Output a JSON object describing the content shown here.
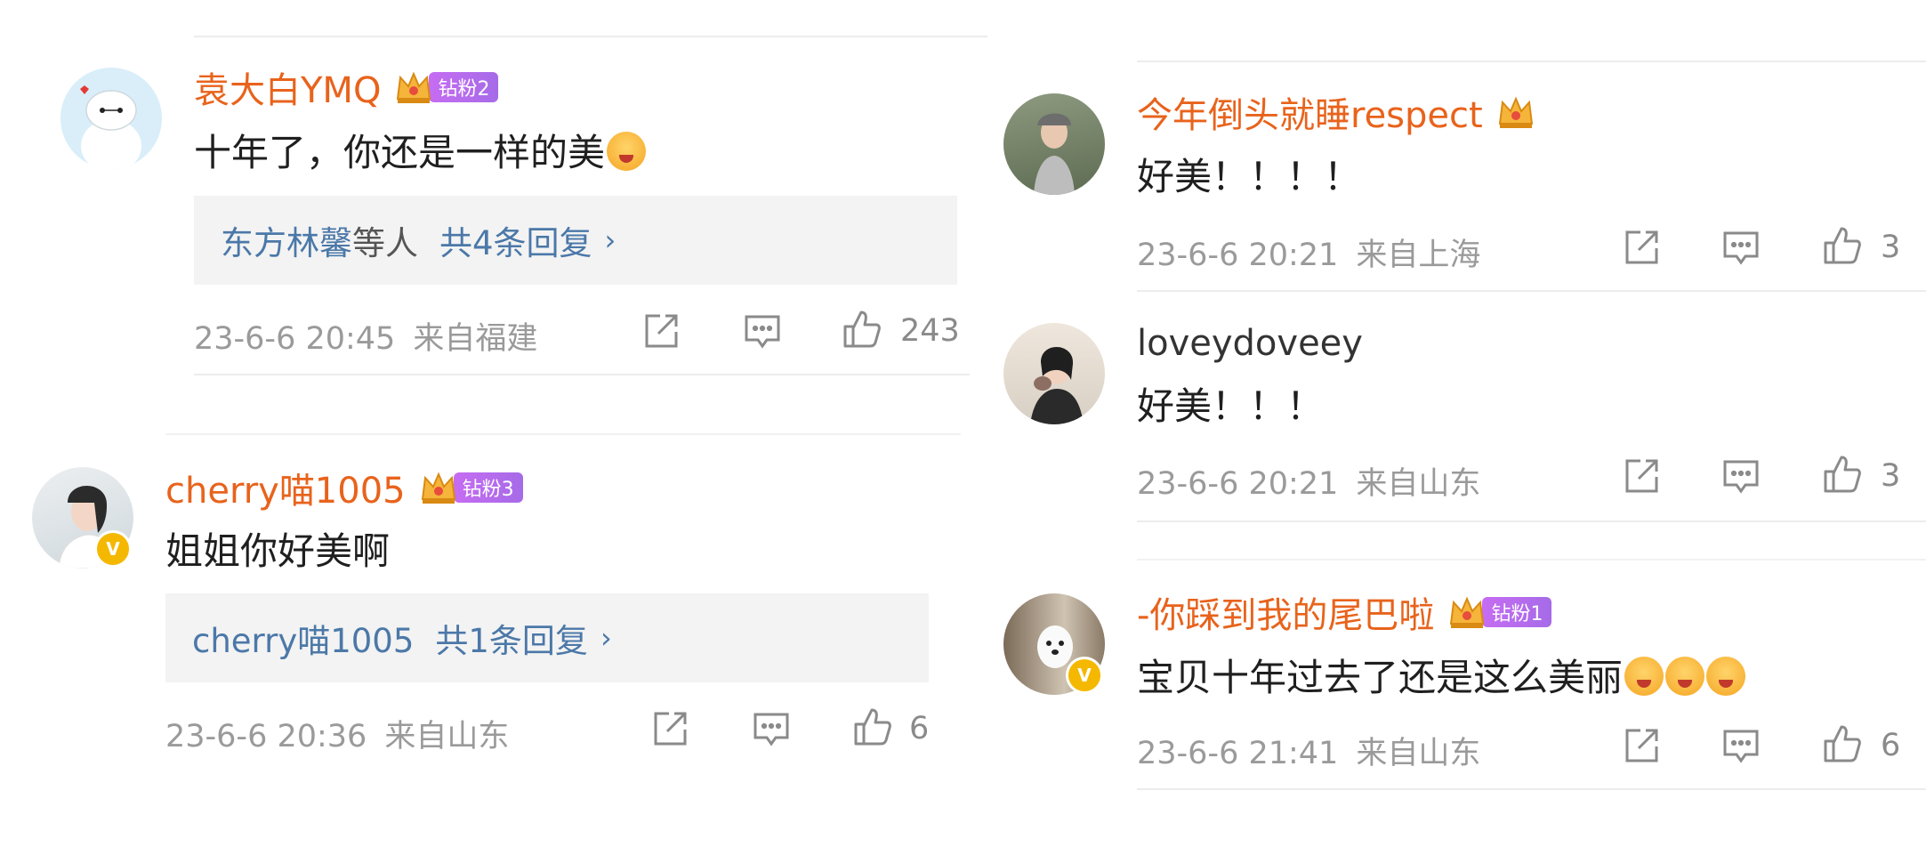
{
  "comments": [
    {
      "name": "袁大白YMQ",
      "fan_badge": "钻粉2",
      "text": "十年了，你还是一样的美",
      "reply_users": "东方林馨",
      "reply_etc": "等人",
      "reply_count": "共4条回复",
      "time": "23-6-6 20:45",
      "location": "来自福建",
      "likes": "243"
    },
    {
      "name": "cherry喵1005",
      "fan_badge": "钻粉3",
      "text": "姐姐你好美啊",
      "reply_users": "cherry喵1005",
      "reply_count": "共1条回复",
      "time": "23-6-6 20:36",
      "location": "来自山东",
      "likes": "6"
    },
    {
      "name": "今年倒头就睡respect",
      "text": "好美！！！！",
      "time": "23-6-6 20:21",
      "location": "来自上海",
      "likes": "3"
    },
    {
      "name": "loveydoveey",
      "text": "好美！！！",
      "time": "23-6-6 20:21",
      "location": "来自山东",
      "likes": "3"
    },
    {
      "name": "-你踩到我的尾巴啦",
      "fan_badge": "钻粉1",
      "text": "宝贝十年过去了还是这么美丽",
      "time": "23-6-6 21:41",
      "location": "来自山东",
      "likes": "6"
    }
  ],
  "icons": {
    "share": "share-icon",
    "comment": "comment-icon",
    "like": "thumbs-up-icon",
    "crown": "crown-icon",
    "verified": "verified-icon"
  },
  "colors": {
    "username": "#e8631c",
    "reply_link": "#4b78a8",
    "meta": "#9a9a9a",
    "fan_badge": "#b66cf0"
  }
}
